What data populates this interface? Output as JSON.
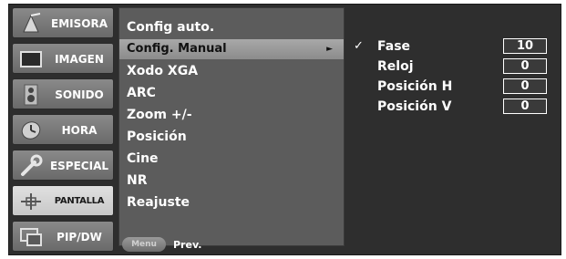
{
  "sidebar": {
    "items": [
      {
        "label": "EMISORA",
        "icon": "antenna-icon"
      },
      {
        "label": "IMAGEN",
        "icon": "screen-icon"
      },
      {
        "label": "SONIDO",
        "icon": "speaker-icon"
      },
      {
        "label": "HORA",
        "icon": "clock-icon"
      },
      {
        "label": "ESPECIAL",
        "icon": "wrench-icon"
      },
      {
        "label": "PANTALLA",
        "icon": "adjust-icon"
      },
      {
        "label": "PIP/DW",
        "icon": "pip-icon"
      }
    ],
    "active_index": 5
  },
  "menu": {
    "items": [
      {
        "label": "Config auto."
      },
      {
        "label": "Config. Manual"
      },
      {
        "label": "Xodo XGA"
      },
      {
        "label": "ARC"
      },
      {
        "label": "Zoom +/-"
      },
      {
        "label": "Posición"
      },
      {
        "label": "Cine"
      },
      {
        "label": "NR"
      },
      {
        "label": "Reajuste"
      }
    ],
    "selected_index": 1,
    "arrow": "►"
  },
  "footer": {
    "menu_key": "Menu",
    "prev_label": "Prev."
  },
  "submenu": {
    "check": "✓",
    "rows": [
      {
        "label": "Fase",
        "value": "10"
      },
      {
        "label": "Reloj",
        "value": "0"
      },
      {
        "label": "Posición H",
        "value": "0"
      },
      {
        "label": "Posición V",
        "value": "0"
      }
    ]
  },
  "colors": {
    "background": "#2e2e2e",
    "menu_panel": "#5c5c5c",
    "selected": "#a8a8a8",
    "text": "#ffffff"
  }
}
